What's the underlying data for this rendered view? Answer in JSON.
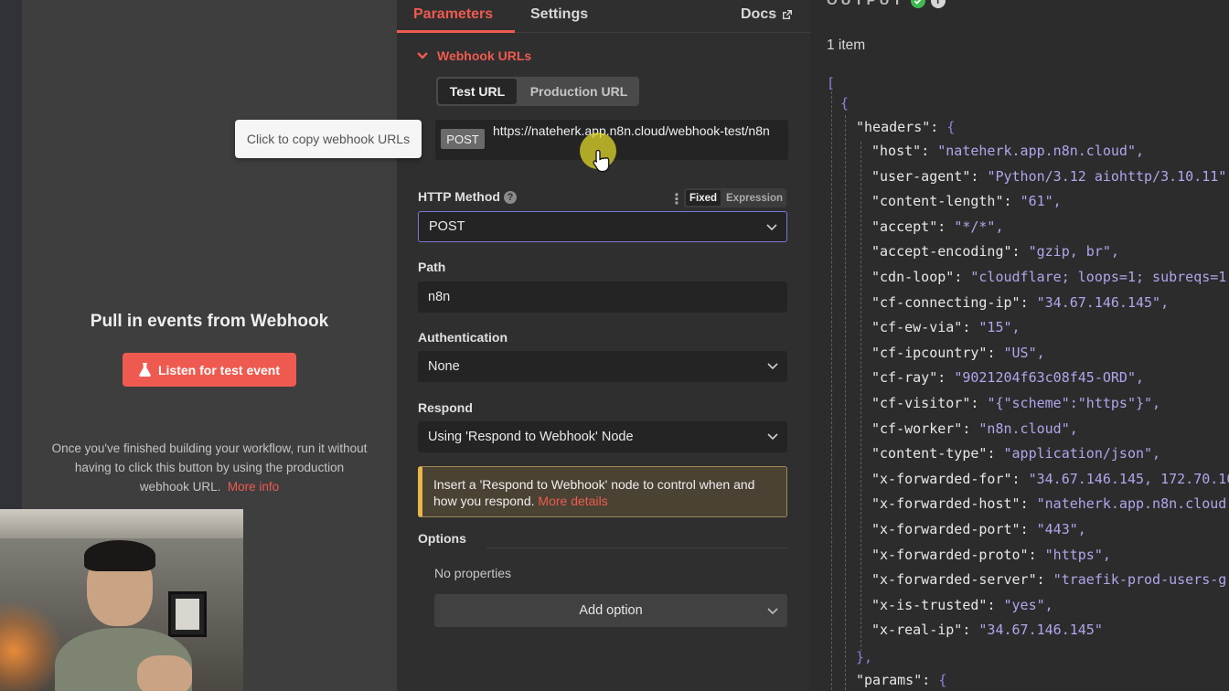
{
  "tabs": {
    "parameters": "Parameters",
    "settings": "Settings",
    "docs": "Docs"
  },
  "input_panel": {
    "title": "Pull in events from Webhook",
    "listen_button": "Listen for test event",
    "help_text": "Once you've finished building your workflow, run it without having to click this button by using the production webhook URL.",
    "more_info_link": "More info"
  },
  "tooltip": "Click to copy webhook URLs",
  "webhook_urls": {
    "header": "Webhook URLs",
    "toggle_test": "Test URL",
    "toggle_production": "Production URL",
    "method": "POST",
    "url": "https://nateherk.app.n8n.cloud/webhook-test/n8n"
  },
  "http_method": {
    "label": "HTTP Method",
    "fixed": "Fixed",
    "expression": "Expression",
    "value": "POST"
  },
  "path": {
    "label": "Path",
    "value": "n8n"
  },
  "authentication": {
    "label": "Authentication",
    "value": "None"
  },
  "respond": {
    "label": "Respond",
    "value": "Using 'Respond to Webhook' Node"
  },
  "notice": {
    "text": "Insert a 'Respond to Webhook' node to control when and how you respond.",
    "link": "More details"
  },
  "options": {
    "label": "Options",
    "empty": "No properties",
    "add_button": "Add option"
  },
  "output": {
    "title": "OUTPUT",
    "item_count": "1 item",
    "headers_key": "\"headers\"",
    "params_key": "\"params\"",
    "headers": [
      {
        "key": "\"host\"",
        "value": "\"nateherk.app.n8n.cloud\","
      },
      {
        "key": "\"user-agent\"",
        "value": "\"Python/3.12 aiohttp/3.10.11\""
      },
      {
        "key": "\"content-length\"",
        "value": "\"61\","
      },
      {
        "key": "\"accept\"",
        "value": "\"*/*\","
      },
      {
        "key": "\"accept-encoding\"",
        "value": "\"gzip, br\","
      },
      {
        "key": "\"cdn-loop\"",
        "value": "\"cloudflare; loops=1; subreqs=1"
      },
      {
        "key": "\"cf-connecting-ip\"",
        "value": "\"34.67.146.145\","
      },
      {
        "key": "\"cf-ew-via\"",
        "value": "\"15\","
      },
      {
        "key": "\"cf-ipcountry\"",
        "value": "\"US\","
      },
      {
        "key": "\"cf-ray\"",
        "value": "\"9021204f63c08f45-ORD\","
      },
      {
        "key": "\"cf-visitor\"",
        "value": "\"{\"scheme\":\"https\"}\","
      },
      {
        "key": "\"cf-worker\"",
        "value": "\"n8n.cloud\","
      },
      {
        "key": "\"content-type\"",
        "value": "\"application/json\","
      },
      {
        "key": "\"x-forwarded-for\"",
        "value": "\"34.67.146.145, 172.70.10"
      },
      {
        "key": "\"x-forwarded-host\"",
        "value": "\"nateherk.app.n8n.cloud"
      },
      {
        "key": "\"x-forwarded-port\"",
        "value": "\"443\","
      },
      {
        "key": "\"x-forwarded-proto\"",
        "value": "\"https\","
      },
      {
        "key": "\"x-forwarded-server\"",
        "value": "\"traefik-prod-users-g"
      },
      {
        "key": "\"x-is-trusted\"",
        "value": "\"yes\","
      },
      {
        "key": "\"x-real-ip\"",
        "value": "\"34.67.146.145\""
      }
    ]
  },
  "colors": {
    "accent": "#ef5a50",
    "json_string": "#b0a6ec",
    "success": "#3fb950",
    "warning_border": "#e8b64a"
  },
  "icons": [
    "flask-icon",
    "external-link-icon",
    "chevron-down-icon",
    "help-icon",
    "check-circle-icon",
    "info-icon",
    "pointer-cursor-icon"
  ]
}
